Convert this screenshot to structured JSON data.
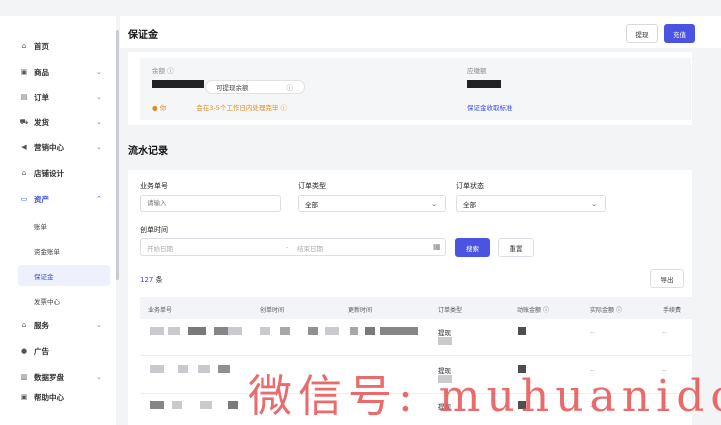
{
  "sidebar": {
    "items": [
      {
        "label": "首页",
        "icon": "home-icon"
      },
      {
        "label": "商品",
        "icon": "product-icon"
      },
      {
        "label": "订单",
        "icon": "order-icon"
      },
      {
        "label": "发货",
        "icon": "shipping-icon"
      },
      {
        "label": "营销中心",
        "icon": "megaphone-icon"
      },
      {
        "label": "店铺设计",
        "icon": "store-icon"
      },
      {
        "label": "资产",
        "icon": "wallet-icon"
      },
      {
        "label": "服务",
        "icon": "service-icon"
      },
      {
        "label": "广告",
        "icon": "ad-icon"
      },
      {
        "label": "数据罗盘",
        "icon": "chart-icon"
      },
      {
        "label": "帮助中心",
        "icon": "help-icon"
      }
    ],
    "asset_sub": [
      "账单",
      "资金账单",
      "保证金",
      "发票中心"
    ],
    "selected_sub": "保证金"
  },
  "header": {
    "title": "保证金",
    "withdraw_label": "提现",
    "recharge_label": "充值"
  },
  "balance": {
    "balance_label": "余额",
    "withdrawable_label": "可提现余额",
    "payable_label": "应缴额",
    "notice_prefix": "● 你",
    "notice_suffix": "会在3-5个工作日内处理完毕",
    "standard_link": "保证金收取标准"
  },
  "flow": {
    "title": "流水记录",
    "filters": {
      "business_no_label": "业务单号",
      "business_no_placeholder": "请输入",
      "order_type_label": "订单类型",
      "order_type_value": "全部",
      "order_status_label": "订单状态",
      "order_status_value": "全部",
      "created_time_label": "创单时间",
      "start_placeholder": "开始日期",
      "range_sep": "-",
      "end_placeholder": "结束日期"
    },
    "search_label": "搜索",
    "reset_label": "重置",
    "count_number": "127",
    "count_unit": "条",
    "export_label": "导出",
    "columns": [
      "业务单号",
      "创单时间",
      "更新时间",
      "订单类型",
      "动账金额",
      "实际金额",
      "手续费"
    ],
    "rows": [
      {
        "type": "提现",
        "actual": "--",
        "fee": "--"
      },
      {
        "type": "提现",
        "actual": "--",
        "fee": "--"
      },
      {
        "type": "提现",
        "actual": "--",
        "fee": "--"
      }
    ]
  },
  "watermark": "微信号: muhuanidc"
}
